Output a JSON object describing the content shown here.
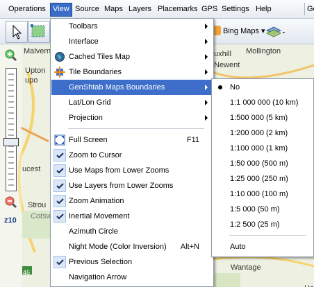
{
  "menubar": {
    "items": [
      "Operations",
      "View",
      "Source",
      "Maps",
      "Layers",
      "Placemarks",
      "GPS",
      "Settings",
      "Help"
    ],
    "active": "View",
    "overflow": "Go"
  },
  "toolbar": {
    "map_source": "Bing Maps"
  },
  "map": {
    "labels": [
      "Malvern",
      "Upton",
      "upo",
      "Newent",
      "uxhill",
      "Mollington",
      "ucest",
      "Strou",
      "Cotsw",
      "Wantage",
      "46",
      "Ha"
    ],
    "zoom_level": "z10"
  },
  "view_menu": {
    "items": [
      {
        "label": "Toolbars",
        "submenu": true
      },
      {
        "label": "Interface",
        "submenu": true
      },
      {
        "label": "Cached Tiles Map",
        "submenu": true,
        "icon": "globe-icon"
      },
      {
        "label": "Tile Boundaries",
        "submenu": true,
        "icon": "tile-boundaries-icon"
      },
      {
        "label": "GenShtab Maps Boundaries",
        "submenu": true,
        "highlighted": true
      },
      {
        "label": "Lat/Lon Grid",
        "submenu": true
      },
      {
        "label": "Projection",
        "submenu": true
      },
      {
        "label": "Full Screen",
        "shortcut": "F11",
        "icon": "fullscreen-icon"
      },
      {
        "label": "Zoom to Cursor",
        "checked": true
      },
      {
        "label": "Use Maps from Lower Zooms",
        "checked": true
      },
      {
        "label": "Use Layers from Lower Zooms",
        "checked": true
      },
      {
        "label": "Zoom Animation",
        "checked": true
      },
      {
        "label": "Inertial Movement",
        "checked": true
      },
      {
        "label": "Azimuth Circle"
      },
      {
        "label": "Night Mode (Color Inversion)",
        "shortcut": "Alt+N"
      },
      {
        "label": "Previous Selection",
        "checked": true
      },
      {
        "label": "Navigation Arrow"
      }
    ]
  },
  "genshtab_submenu": {
    "items": [
      {
        "label": "No",
        "selected": true
      },
      {
        "label": "1:1 000 000 (10 km)"
      },
      {
        "label": "1:500 000 (5 km)"
      },
      {
        "label": "1:200 000 (2 km)"
      },
      {
        "label": "1:100 000 (1 km)"
      },
      {
        "label": "1:50 000 (500 m)"
      },
      {
        "label": "1:25 000 (250 m)"
      },
      {
        "label": "1:10 000 (100 m)"
      },
      {
        "label": "1:5 000 (50 m)"
      },
      {
        "label": "1:2 500 (25 m)"
      },
      {
        "label": "Auto"
      }
    ]
  }
}
